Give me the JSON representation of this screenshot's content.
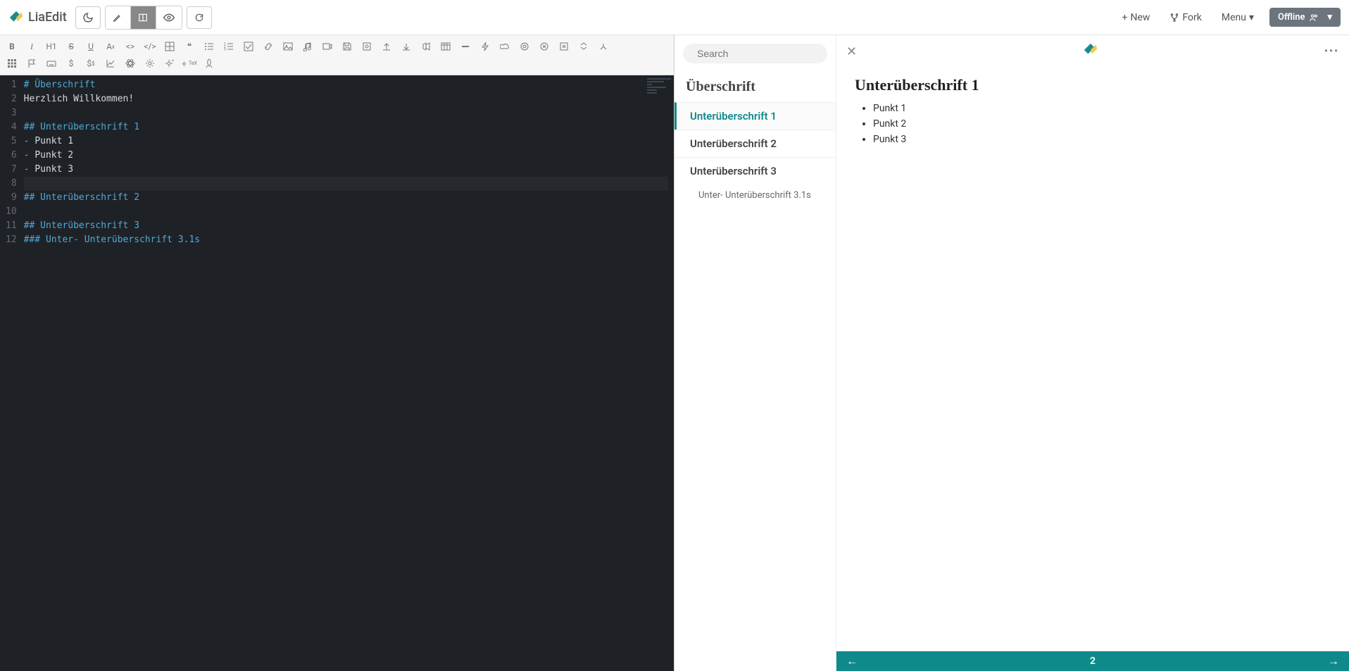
{
  "header": {
    "app_name": "LiaEdit",
    "new_label": "New",
    "fork_label": "Fork",
    "menu_label": "Menu",
    "offline_label": "Offline"
  },
  "editor": {
    "lines": [
      {
        "n": 1,
        "cls": "hd",
        "text": "# Überschrift"
      },
      {
        "n": 2,
        "cls": "tx",
        "text": "Herzlich Willkommen!"
      },
      {
        "n": 3,
        "cls": "tx",
        "text": ""
      },
      {
        "n": 4,
        "cls": "hd",
        "text": "## Unterüberschrift 1"
      },
      {
        "n": 5,
        "cls": "ls",
        "text": "- Punkt 1"
      },
      {
        "n": 6,
        "cls": "ls",
        "text": "- Punkt 2"
      },
      {
        "n": 7,
        "cls": "ls",
        "text": "- Punkt 3"
      },
      {
        "n": 8,
        "cls": "tx",
        "text": "",
        "cursor": true
      },
      {
        "n": 9,
        "cls": "hd",
        "text": "## Unterüberschrift 2"
      },
      {
        "n": 10,
        "cls": "tx",
        "text": ""
      },
      {
        "n": 11,
        "cls": "hd",
        "text": "## Unterüberschrift 3"
      },
      {
        "n": 12,
        "cls": "hd",
        "text": "### Unter- Unterüberschrift 3.1s"
      }
    ]
  },
  "toc": {
    "search_placeholder": "Search",
    "title": "Überschrift",
    "items": [
      {
        "label": "Unterüberschrift 1",
        "active": true
      },
      {
        "label": "Unterüberschrift 2",
        "active": false
      },
      {
        "label": "Unterüberschrift 3",
        "active": false
      }
    ],
    "sub_items": [
      {
        "label": "Unter- Unterüberschrift 3.1s"
      }
    ]
  },
  "preview": {
    "heading": "Unterüberschrift 1",
    "bullets": [
      "Punkt 1",
      "Punkt 2",
      "Punkt 3"
    ],
    "page_number": "2"
  }
}
